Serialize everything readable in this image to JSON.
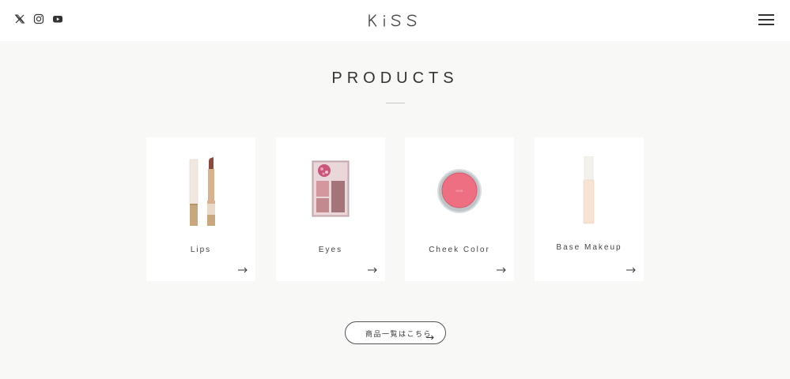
{
  "header": {
    "logo_text": "KiSS",
    "social": [
      {
        "icon": "x-twitter-icon"
      },
      {
        "icon": "instagram-icon"
      },
      {
        "icon": "youtube-icon"
      }
    ],
    "menu_icon": "hamburger-menu-icon"
  },
  "section": {
    "title": "PRODUCTS"
  },
  "products": [
    {
      "label": "Lips",
      "icon": "lipstick-icon"
    },
    {
      "label": "Eyes",
      "icon": "eyeshadow-palette-icon"
    },
    {
      "label": "Cheek Color",
      "icon": "blush-compact-icon"
    },
    {
      "label": "Base Makeup",
      "icon": "foundation-bottle-icon"
    }
  ],
  "all_products_button": {
    "label": "商品一覧はこちら"
  },
  "colors": {
    "page_background": "#f8f8f7",
    "card_background": "#ffffff",
    "text": "#333333",
    "blush": "#ef6f82"
  }
}
